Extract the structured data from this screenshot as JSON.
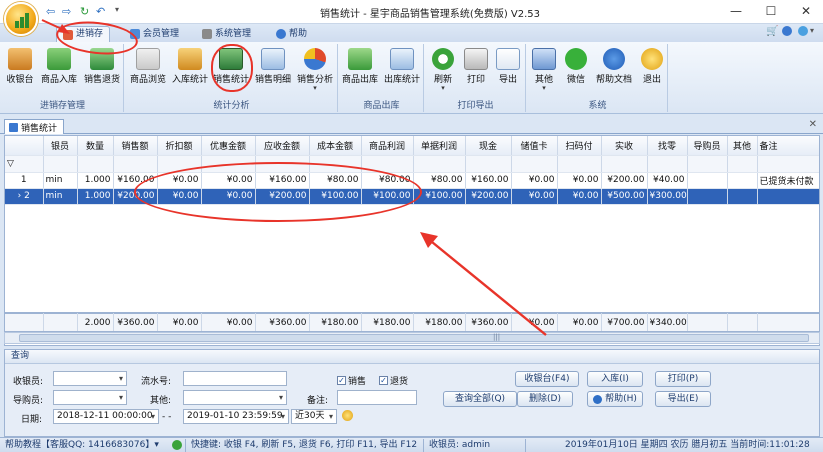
{
  "window": {
    "title": "销售统计 - 星宇商品销售管理系统(免费版) V2.53",
    "min_label": "—",
    "max_label": "☐",
    "close_label": "✕"
  },
  "quick_access": [
    "⇦",
    "⇨",
    "↻",
    "↶",
    "▾"
  ],
  "tabs": [
    {
      "label": "进销存"
    },
    {
      "label": "会员管理"
    },
    {
      "label": "系统管理"
    },
    {
      "label": "帮助"
    }
  ],
  "ribbon": {
    "groups": [
      {
        "label": "进销存管理",
        "buttons": [
          "收银台",
          "商品入库",
          "销售退货"
        ]
      },
      {
        "label": "统计分析",
        "buttons": [
          "商品浏览",
          "入库统计",
          "销售统计",
          "销售明细",
          "销售分析"
        ]
      },
      {
        "label": "商品出库",
        "buttons": [
          "商品出库",
          "出库统计"
        ]
      },
      {
        "label": "打印导出",
        "buttons": [
          "刷新",
          "打印",
          "导出"
        ]
      },
      {
        "label": "系统",
        "buttons": [
          "其他",
          "微信",
          "帮助文档",
          "退出"
        ]
      }
    ]
  },
  "doc_tab": {
    "label": "销售统计",
    "close": "✕"
  },
  "grid": {
    "filter_marker": "▽",
    "columns": [
      "",
      "银员",
      "数量",
      "销售额",
      "折扣额",
      "优惠金额",
      "应收金额",
      "成本金额",
      "商品利润",
      "单据利润",
      "现金",
      "储值卡",
      "扫码付",
      "实收",
      "找零",
      "导购员",
      "其他",
      "备注"
    ],
    "rows": [
      {
        "no": "1",
        "cells": [
          "min",
          "1.000",
          "¥160.00",
          "¥0.00",
          "¥0.00",
          "¥160.00",
          "¥80.00",
          "¥80.00",
          "¥80.00",
          "¥160.00",
          "¥0.00",
          "¥0.00",
          "¥200.00",
          "¥40.00",
          "",
          "",
          "已提货未付款"
        ]
      },
      {
        "no": "› 2",
        "cells": [
          "min",
          "1.000",
          "¥200.00",
          "¥0.00",
          "¥0.00",
          "¥200.00",
          "¥100.00",
          "¥100.00",
          "¥100.00",
          "¥200.00",
          "¥0.00",
          "¥0.00",
          "¥500.00",
          "¥300.00",
          "",
          "",
          ""
        ]
      }
    ],
    "summary": [
      "",
      "",
      "2.000",
      "¥360.00",
      "¥0.00",
      "¥0.00",
      "¥360.00",
      "¥180.00",
      "¥180.00",
      "¥180.00",
      "¥360.00",
      "¥0.00",
      "¥0.00",
      "¥700.00",
      "¥340.00",
      "",
      "",
      ""
    ],
    "scroll_mid": "|||"
  },
  "query": {
    "title": "查询",
    "cashier_label": "收银员:",
    "guide_label": "导购员:",
    "serial_label": "流水号:",
    "other_label": "其他:",
    "remark_label": "备注:",
    "date_label": "日期:",
    "date_from": "2018-12-11 00:00:00",
    "date_sep": "- -",
    "date_to": "2019-01-10 23:59:59",
    "period": "近30天",
    "chk_sale": "销售",
    "chk_return": "退货",
    "buttons": {
      "query_all": "查询全部(Q)",
      "cashier": "收银台(F4)",
      "delete": "删除(D)",
      "stock_in": "入库(I)",
      "help": "帮助(H)",
      "print": "打印(P)",
      "export": "导出(E)"
    }
  },
  "status": {
    "help": "帮助教程【客服QQ: 1416683076】▾",
    "shortcuts": "快捷键: 收银 F4, 刷新 F5, 退货 F6, 打印 F11, 导出 F12",
    "cashier": "收银员: admin",
    "datetime": "2019年01月10日 星期四 农历 腊月初五 当前时间:11:01:28"
  },
  "colors": {
    "annotation": "#e8342a",
    "selected_row": "#2f63b8"
  }
}
